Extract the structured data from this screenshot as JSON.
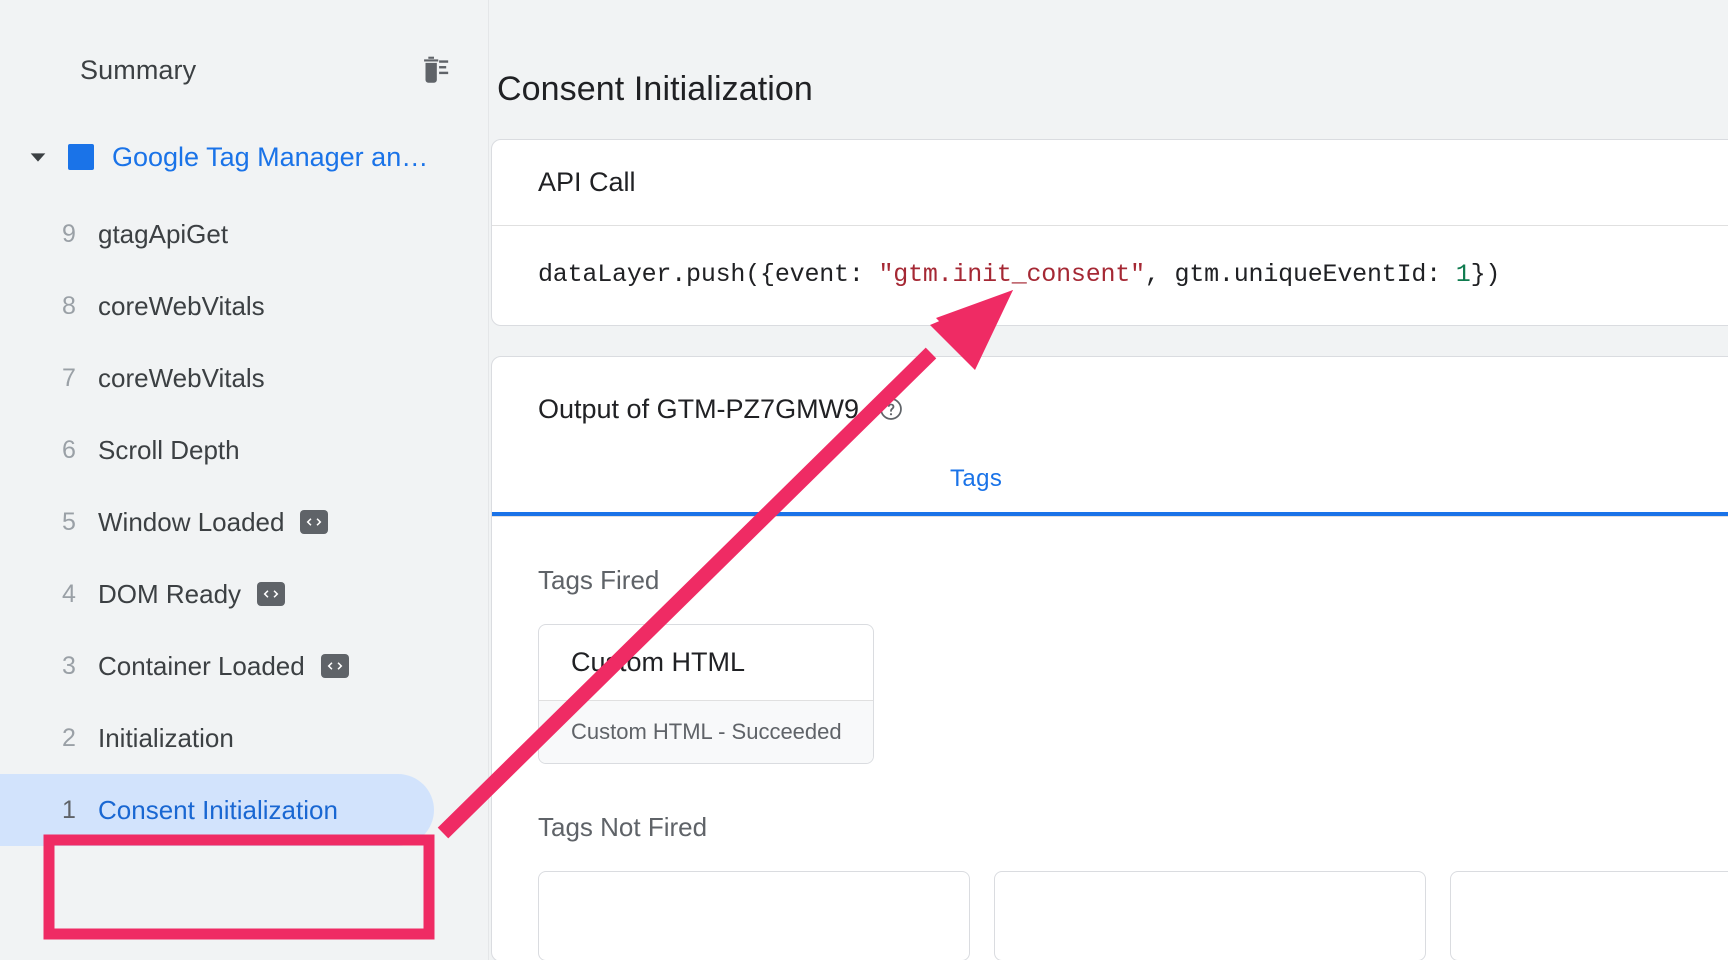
{
  "sidebar": {
    "title": "Summary",
    "clear_icon": "trash-clear-icon",
    "tree": {
      "caret_icon": "chevron-down-icon",
      "swatch_color": "#1a73e8",
      "label": "Google Tag Manager an…"
    },
    "events": [
      {
        "index": "9",
        "label": "gtagApiGet",
        "has_code_icon": false,
        "selected": false
      },
      {
        "index": "8",
        "label": "coreWebVitals",
        "has_code_icon": false,
        "selected": false
      },
      {
        "index": "7",
        "label": "coreWebVitals",
        "has_code_icon": false,
        "selected": false
      },
      {
        "index": "6",
        "label": "Scroll Depth",
        "has_code_icon": false,
        "selected": false
      },
      {
        "index": "5",
        "label": "Window Loaded",
        "has_code_icon": true,
        "selected": false
      },
      {
        "index": "4",
        "label": "DOM Ready",
        "has_code_icon": true,
        "selected": false
      },
      {
        "index": "3",
        "label": "Container Loaded",
        "has_code_icon": true,
        "selected": false
      },
      {
        "index": "2",
        "label": "Initialization",
        "has_code_icon": false,
        "selected": false
      },
      {
        "index": "1",
        "label": "Consent Initialization",
        "has_code_icon": false,
        "selected": true
      }
    ]
  },
  "main": {
    "page_title": "Consent Initialization",
    "api_call": {
      "heading": "API Call",
      "code_prefix": "dataLayer.push({event: ",
      "code_string": "\"gtm.init_consent\"",
      "code_middle": ", gtm.uniqueEventId: ",
      "code_number": "1",
      "code_suffix": "})"
    },
    "output": {
      "heading": "Output of GTM-PZ7GMW9",
      "help_icon": "help-circle-icon",
      "tabs": [
        {
          "label": "Tags",
          "active": true
        }
      ],
      "tags_fired": {
        "label": "Tags Fired",
        "cards": [
          {
            "title": "Custom HTML",
            "status": "Custom HTML - Succeeded"
          }
        ]
      },
      "tags_not_fired": {
        "label": "Tags Not Fired",
        "cards": [
          {
            "title": ""
          },
          {
            "title": ""
          },
          {
            "title": ""
          }
        ]
      }
    }
  },
  "annotations": {
    "highlight_color": "#ef2b64",
    "arrow_name": "pink-arrow-annotation",
    "box_name": "pink-highlight-box"
  }
}
